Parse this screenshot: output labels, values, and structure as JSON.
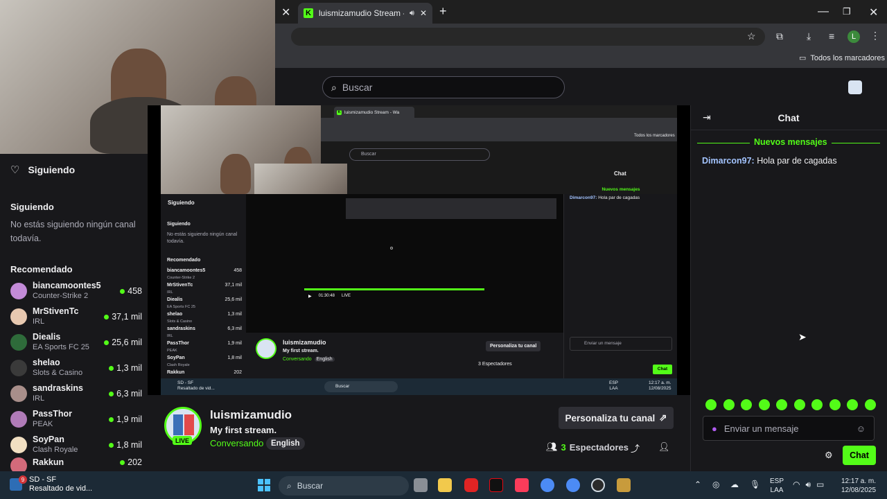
{
  "chrome": {
    "tab_title": "luismizamudio Stream - Wa",
    "bookmarks_label": "Todos los marcadores",
    "profile_initial": "L"
  },
  "kick": {
    "search_placeholder": "Buscar"
  },
  "sidebar": {
    "following_title": "Siguiendo",
    "following_subtitle": "Siguiendo",
    "following_empty": "No estás siguiendo ningún canal todavía.",
    "recommended_title": "Recomendado",
    "recommended": [
      {
        "name": "biancamoontes5",
        "category": "Counter-Strike 2",
        "viewers": "458"
      },
      {
        "name": "MrStivenTc",
        "category": "IRL",
        "viewers": "37,1 mil"
      },
      {
        "name": "Diealis",
        "category": "EA Sports FC 25",
        "viewers": "25,6 mil"
      },
      {
        "name": "shelao",
        "category": "Slots & Casino",
        "viewers": "1,3 mil"
      },
      {
        "name": "sandraskins",
        "category": "IRL",
        "viewers": "6,3 mil"
      },
      {
        "name": "PassThor",
        "category": "PEAK",
        "viewers": "1,9 mil"
      },
      {
        "name": "SoyPan",
        "category": "Clash Royale",
        "viewers": "1,8 mil"
      },
      {
        "name": "Rakkun",
        "category": "",
        "viewers": "202"
      }
    ]
  },
  "channel": {
    "name": "luismizamudio",
    "title": "My first stream.",
    "category": "Conversando",
    "language": "English",
    "live_label": "LIVE",
    "customize_label": "Personaliza tu canal",
    "viewers_count": "3",
    "viewers_label": "Espectadores"
  },
  "chat": {
    "title": "Chat",
    "new_messages": "Nuevos mensajes",
    "messages": [
      {
        "user": "Dimarcon97:",
        "text": "Hola par de cagadas"
      }
    ],
    "input_placeholder": "Enviar un mensaje",
    "send_label": "Chat"
  },
  "nested": {
    "tab_title": "luismizamudio Stream - Wa",
    "bookmarks_label": "Todos los marcadores",
    "search": "Buscar",
    "following_title": "Siguiendo",
    "following_subtitle": "Siguiendo",
    "following_empty": "No estás siguiendo ningún canal todavía.",
    "recommended_title": "Recomendado",
    "recommended": [
      {
        "name": "biancamoontes5",
        "category": "Counter-Strike 2",
        "viewers": "458"
      },
      {
        "name": "MrStivenTc",
        "category": "IRL",
        "viewers": "37,1 mil"
      },
      {
        "name": "Diealis",
        "category": "EA Sports FC 25",
        "viewers": "25,6 mil"
      },
      {
        "name": "shelao",
        "category": "Slots & Casino",
        "viewers": "1,3 mil"
      },
      {
        "name": "sandraskins",
        "category": "IRL",
        "viewers": "6,3 mil"
      },
      {
        "name": "PassThor",
        "category": "PEAK",
        "viewers": "1,9 mil"
      },
      {
        "name": "SoyPan",
        "category": "Clash Royale",
        "viewers": "1,8 mil"
      },
      {
        "name": "Rakkun",
        "category": "",
        "viewers": "202"
      }
    ],
    "chat_title": "Chat",
    "new_messages": "Nuevos mensajes",
    "chat_user": "Dimarcon97:",
    "chat_text": "Hola par de cagadas",
    "player_time": "01:30:48",
    "player_live": "LIVE",
    "channel_name": "luismizamudio",
    "channel_title": "My first stream.",
    "channel_category": "Conversando",
    "channel_language": "English",
    "customize_label": "Personaliza tu canal",
    "viewers": "3 Espectadores",
    "chat_placeholder": "Enviar un mensaje",
    "chat_send": "Chat",
    "tb_app_title": "SD - SF",
    "tb_app_sub": "Resaltado de vid...",
    "tb_search": "Buscar",
    "tb_lang": "ESP",
    "tb_lang2": "LAA",
    "tb_time": "12:17 a. m.",
    "tb_date": "12/08/2025"
  },
  "taskbar": {
    "app_title": "SD - SF",
    "app_subtitle": "Resaltado de vid...",
    "badge": "9",
    "search_label": "Buscar",
    "lang": "ESP",
    "lang2": "LAA",
    "time": "12:17 a. m.",
    "date": "12/08/2025"
  },
  "colors": {
    "kick_green": "#53fc18",
    "bg": "#18181b"
  }
}
